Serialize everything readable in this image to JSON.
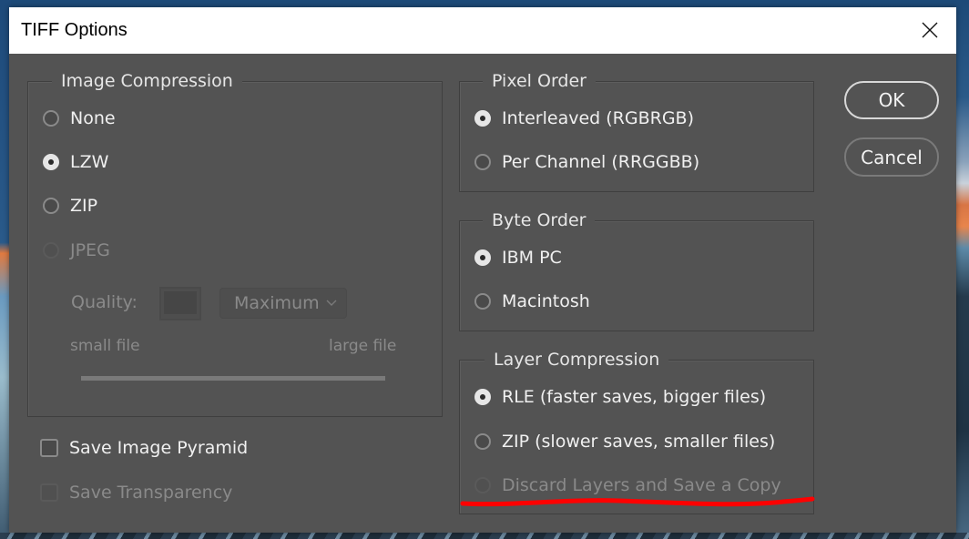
{
  "dialog": {
    "title": "TIFF Options",
    "close_icon": "close-icon"
  },
  "image_compression": {
    "legend": "Image Compression",
    "options": [
      {
        "label": "None",
        "checked": false,
        "disabled": false
      },
      {
        "label": "LZW",
        "checked": true,
        "disabled": false
      },
      {
        "label": "ZIP",
        "checked": false,
        "disabled": false
      },
      {
        "label": "JPEG",
        "checked": false,
        "disabled": true
      }
    ],
    "quality_label": "Quality:",
    "quality_value": "",
    "quality_select": "Maximum",
    "small_file_label": "small file",
    "large_file_label": "large file"
  },
  "checkboxes": [
    {
      "label": "Save Image Pyramid",
      "checked": false,
      "disabled": false
    },
    {
      "label": "Save Transparency",
      "checked": false,
      "disabled": true
    }
  ],
  "pixel_order": {
    "legend": "Pixel Order",
    "options": [
      {
        "label": "Interleaved (RGBRGB)",
        "checked": true,
        "disabled": false
      },
      {
        "label": "Per Channel (RRGGBB)",
        "checked": false,
        "disabled": false
      }
    ]
  },
  "byte_order": {
    "legend": "Byte Order",
    "options": [
      {
        "label": "IBM PC",
        "checked": true,
        "disabled": false
      },
      {
        "label": "Macintosh",
        "checked": false,
        "disabled": false
      }
    ]
  },
  "layer_compression": {
    "legend": "Layer Compression",
    "options": [
      {
        "label": "RLE (faster saves, bigger files)",
        "checked": true,
        "disabled": false
      },
      {
        "label": "ZIP (slower saves, smaller files)",
        "checked": false,
        "disabled": false
      },
      {
        "label": "Discard Layers and Save a Copy",
        "checked": false,
        "disabled": true
      }
    ]
  },
  "buttons": {
    "ok": "OK",
    "cancel": "Cancel"
  },
  "annotation": {
    "color": "#ff0000",
    "description": "red underline under Discard Layers and Save a Copy"
  }
}
